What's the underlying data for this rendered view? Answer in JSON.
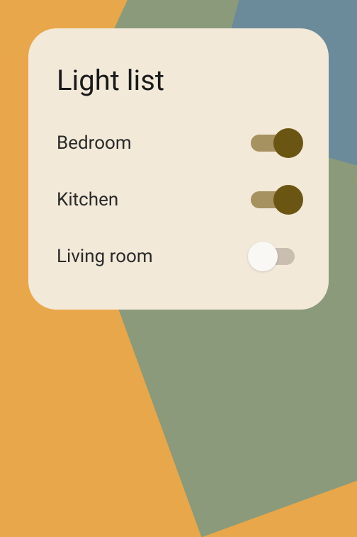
{
  "title": "Light list",
  "lights": [
    {
      "label": "Bedroom",
      "on": true
    },
    {
      "label": "Kitchen",
      "on": true
    },
    {
      "label": "Living room",
      "on": false
    }
  ]
}
